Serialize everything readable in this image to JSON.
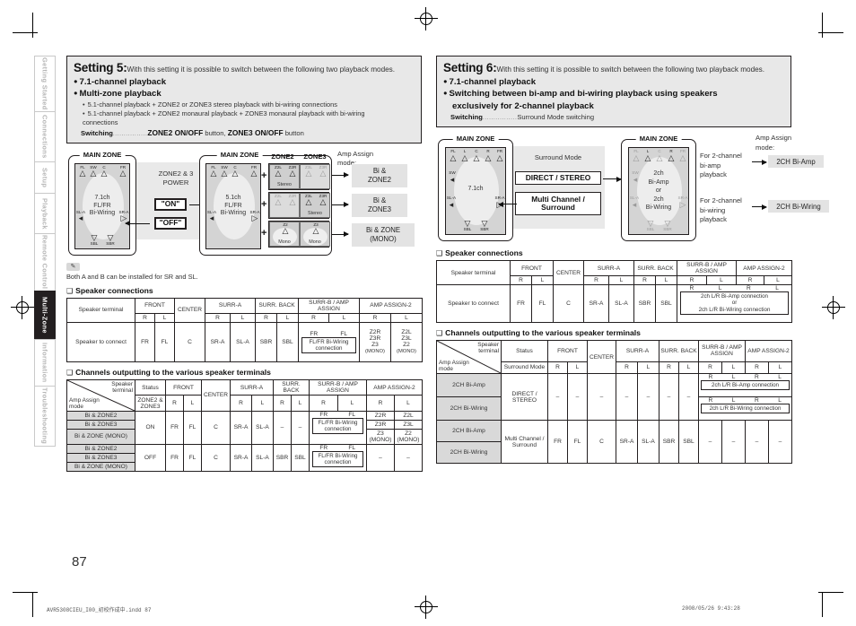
{
  "sidebar": {
    "items": [
      {
        "label": "Getting Started",
        "active": false
      },
      {
        "label": "Connections",
        "active": false
      },
      {
        "label": "Setup",
        "active": false
      },
      {
        "label": "Playback",
        "active": false
      },
      {
        "label": "Remote Control",
        "active": false
      },
      {
        "label": "Multi-Zone",
        "active": true
      },
      {
        "label": "Information",
        "active": false
      },
      {
        "label": "Troubleshooting",
        "active": false
      }
    ]
  },
  "left": {
    "heading": {
      "setting_label": "Setting 5:",
      "intro": "With this setting it is possible to switch between the following two playback modes.",
      "bullet1": "7.1-channel playback",
      "bullet2": "Multi-zone playback",
      "sub1": "5.1-channel playback + ZONE2 or ZONE3 stereo playback with bi-wiring connections",
      "sub2": "5.1-channel playback + ZONE2 monaural playback + ZONE3 monaural playback with bi-wiring",
      "sub2b": "connections",
      "switch_label": "Switching",
      "switch_dots": "................",
      "switch_v1": "ZONE2 ON/OFF",
      "switch_v1_suffix": " button, ",
      "switch_v2": "ZONE3 ON/OFF",
      "switch_v2_suffix": " button"
    },
    "diagram": {
      "zone_title_1": "MAIN ZONE",
      "zone_title_2": "MAIN ZONE",
      "room1_line1": "7.1ch",
      "room1_line2": "FL/FR",
      "room1_line3": "Bi-Wiring",
      "room2_line1": "5.1ch",
      "room2_line2": "FL/FR",
      "room2_line3": "Bi-Wiring",
      "power_label": "ZONE2 & 3",
      "power_label2": "POWER",
      "on_label": "\"ON\"",
      "off_label": "\"OFF\"",
      "zone2_hdr": "ZONE2",
      "zone3_hdr": "ZONE3",
      "stereo": "Stereo",
      "mono": "Mono",
      "amp_assign_title": "Amp Assign",
      "amp_assign_title2": "mode:",
      "amp1a": "Bi &",
      "amp1b": "ZONE2",
      "amp2a": "Bi &",
      "amp2b": "ZONE3",
      "amp3a": "Bi & ZONE",
      "amp3b": "(MONO)",
      "spk_fl": "FL",
      "spk_sw": "SW",
      "spk_c": "C",
      "spk_fr": "FR",
      "spk_sla": "SL-A",
      "spk_sra": "SR-A",
      "spk_sbl": "SBL",
      "spk_sbr": "SBR",
      "z2l": "Z2L",
      "z2r": "Z2R",
      "z3l": "Z3L",
      "z3r": "Z3R",
      "z2": "Z2",
      "z3": "Z3",
      "plus": "+"
    },
    "note": {
      "icon": "pen-icon",
      "text": "Both A and B can be installed for SR and SL."
    },
    "spk_conn": {
      "heading": "Speaker connections",
      "row_label_1": "Speaker terminal",
      "row_label_2": "Speaker to connect",
      "groups": [
        "FRONT",
        "CENTER",
        "SURR-A",
        "SURR. BACK",
        "SURR-B / AMP ASSIGN",
        "AMP ASSIGN-2"
      ],
      "rl": [
        "R",
        "L",
        "R",
        "L",
        "R",
        "L",
        "R",
        "L",
        "R",
        "L"
      ],
      "values": [
        "FR",
        "FL",
        "C",
        "SR-A",
        "SL-A",
        "SBR",
        "SBL"
      ],
      "surrb_r": "FR",
      "surrb_l": "FL",
      "biwire_box": "FL/FR Bi-Wiring connection",
      "amp2_r": [
        "Z2R",
        "Z3R",
        "Z3",
        "(MONO)"
      ],
      "amp2_l": [
        "Z2L",
        "Z3L",
        "Z2",
        "(MONO)"
      ]
    },
    "channels": {
      "heading": "Channels outputting to the various speaker terminals",
      "corner_tl": "Speaker terminal",
      "corner_bl": "Amp Assign mode",
      "status_hdr": "Status",
      "status_sub": "ZONE2 & ZONE3",
      "groups": [
        "FRONT",
        "CENTER",
        "SURR-A",
        "SURR. BACK",
        "SURR-B / AMP ASSIGN",
        "AMP ASSIGN-2"
      ],
      "rl": [
        "R",
        "L",
        "R",
        "L",
        "R",
        "L",
        "R",
        "L",
        "R",
        "L"
      ],
      "modes_on": [
        "Bi & ZONE2",
        "Bi & ZONE3",
        "Bi & ZONE (MONO)"
      ],
      "modes_off": [
        "Bi & ZONE2",
        "Bi & ZONE3",
        "Bi & ZONE (MONO)"
      ],
      "status_on": "ON",
      "status_off": "OFF",
      "on_row": {
        "front_r": "FR",
        "front_l": "FL",
        "center": "C",
        "surra_r": "SR-A",
        "surra_l": "SL-A",
        "surrback_r": "–",
        "surrback_l": "–",
        "surrb_r": "FR",
        "surrb_l": "FL",
        "biwire_box": "FL/FR Bi-Wiring connection",
        "amp2_r": [
          "Z2R",
          "Z3R",
          "Z3 (MONO)"
        ],
        "amp2_l": [
          "Z2L",
          "Z3L",
          "Z2 (MONO)"
        ]
      },
      "off_row": {
        "front_r": "FR",
        "front_l": "FL",
        "center": "C",
        "surra_r": "SR-A",
        "surra_l": "SL-A",
        "surrback_r": "SBR",
        "surrback_l": "SBL",
        "surrb_r": "FR",
        "surrb_l": "FL",
        "biwire_box": "FL/FR Bi-Wiring connection",
        "amp2_r": "–",
        "amp2_l": "–"
      }
    }
  },
  "right": {
    "heading": {
      "setting_label": "Setting 6:",
      "intro": "With this setting it is possible to switch between the following two playback modes.",
      "bullet1": "7.1-channel playback",
      "bullet2": "Switching between bi-amp and bi-wiring playback using speakers",
      "bullet2b": "exclusively for 2-channel playback",
      "switch_label": "Switching",
      "switch_dots": "................",
      "switch_value": "Surround Mode switching"
    },
    "diagram": {
      "zone_title_1": "MAIN ZONE",
      "zone_title_2": "MAIN ZONE",
      "room1_line1": "7.1ch",
      "room2_line1": "2ch",
      "room2_line2": "Bi-Amp",
      "room2_line3": "or",
      "room2_line4": "2ch",
      "room2_line5": "Bi-Wiring",
      "surround_mode_label": "Surround Mode",
      "mode_box_1": "DIRECT / STEREO",
      "mode_box_2a": "Multi Channel /",
      "mode_box_2b": "Surround",
      "for1a": "For 2-channel",
      "for1b": "bi-amp",
      "for1c": "playback",
      "for2a": "For 2-channel",
      "for2b": "bi-wiring",
      "for2c": "playback",
      "amp_assign_title": "Amp Assign",
      "amp_assign_title2": "mode:",
      "amp1": "2CH Bi-Amp",
      "amp2": "2CH Bi-Wiring",
      "spk_fl": "FL",
      "spk_l": "L",
      "spk_c": "C",
      "spk_r": "R",
      "spk_fr": "FR",
      "spk_sw": "SW",
      "spk_sla": "SL-A",
      "spk_sra": "SR-A",
      "spk_sbl": "SBL",
      "spk_sbr": "SBR"
    },
    "spk_conn": {
      "heading": "Speaker connections",
      "row_label_1": "Speaker terminal",
      "row_label_2": "Speaker to connect",
      "groups": [
        "FRONT",
        "CENTER",
        "SURR-A",
        "SURR. BACK",
        "SURR-B / AMP ASSIGN",
        "AMP ASSIGN-2"
      ],
      "rl": [
        "R",
        "L",
        "R",
        "L",
        "R",
        "L",
        "R",
        "L",
        "R",
        "L"
      ],
      "values": [
        "FR",
        "FL",
        "C",
        "SR-A",
        "SL-A",
        "SBR",
        "SBL"
      ],
      "sub_rl": [
        "R",
        "L",
        "R",
        "L"
      ],
      "conn_box_1": "2ch L/R Bi-Amp connection",
      "conn_box_or": "or",
      "conn_box_2": "2ch L/R Bi-Wiring connection"
    },
    "channels": {
      "heading": "Channels outputting to the various speaker terminals",
      "corner_tl": "Speaker terminal",
      "corner_bl": "Amp Assign mode",
      "status_hdr": "Status",
      "status_sub": "Surround Mode",
      "groups": [
        "FRONT",
        "CENTER",
        "SURR-A",
        "SURR. BACK",
        "SURR-B / AMP ASSIGN",
        "AMP ASSIGN-2"
      ],
      "rl": [
        "R",
        "L",
        "R",
        "L",
        "R",
        "L",
        "R",
        "L",
        "R",
        "L"
      ],
      "block1": {
        "modes": [
          "2CH Bi-Amp",
          "2CH Bi-Wiring"
        ],
        "status": "DIRECT / STEREO",
        "dash": "–",
        "sub_rl": [
          "R",
          "L",
          "R",
          "L"
        ],
        "box1": "2ch L/R Bi-Amp connection",
        "box2": "2ch L/R Bi-Wiring connection"
      },
      "block2": {
        "modes": [
          "2CH Bi-Amp",
          "2CH Bi-Wiring"
        ],
        "status": "Multi Channel / Surround",
        "front_r": "FR",
        "front_l": "FL",
        "center": "C",
        "surra_r": "SR-A",
        "surra_l": "SL-A",
        "surrback_r": "SBR",
        "surrback_l": "SBL",
        "dash": "–"
      }
    }
  },
  "footer": {
    "page_number": "87",
    "imprint": "AVR5308CIEU_I00_初校作成中.indd   87",
    "timestamp": "2008/05/26   9:43:28"
  }
}
